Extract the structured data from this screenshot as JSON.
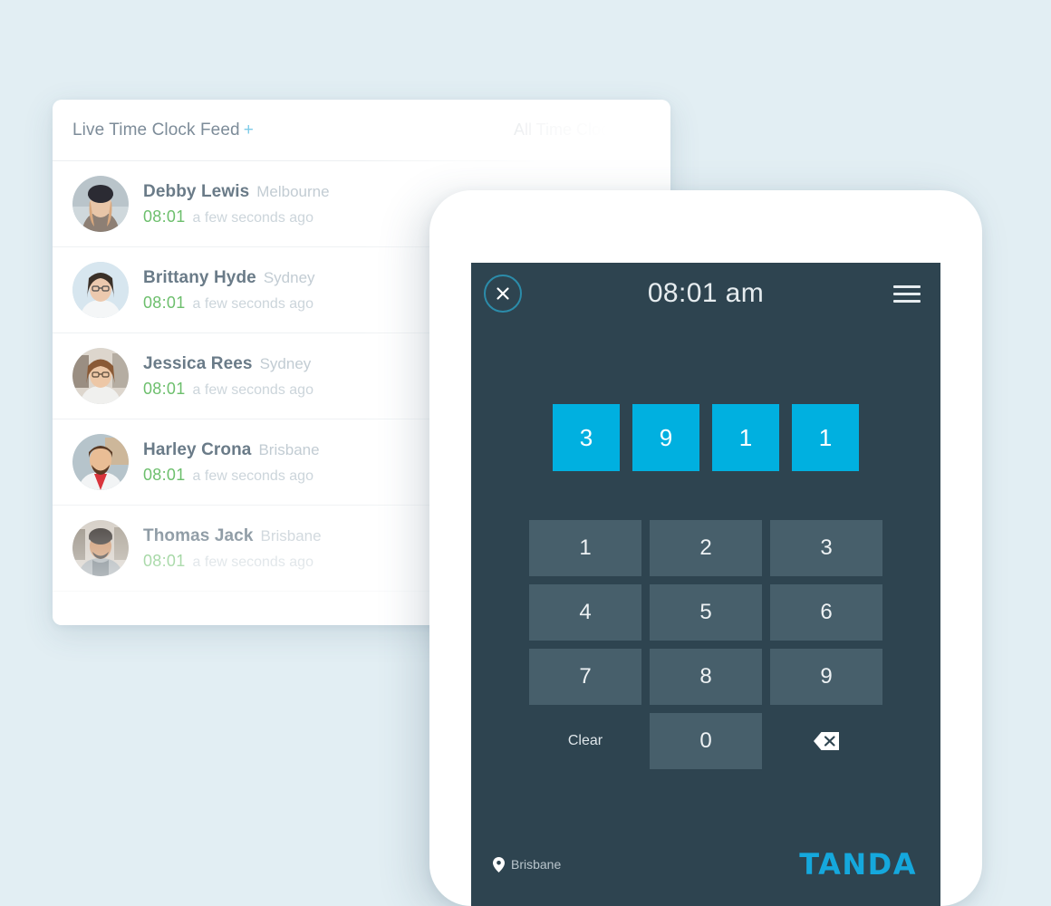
{
  "background_color": "#e2eef3",
  "feed": {
    "title": "Live Time Clock Feed",
    "title_plus": "+",
    "filter_label": "All Time Clocks",
    "filter_caret_icon": "chevron-down-icon",
    "rows": [
      {
        "name": "Debby Lewis",
        "location": "Melbourne",
        "time": "08:01",
        "ago": "a few seconds ago"
      },
      {
        "name": "Brittany Hyde",
        "location": "Sydney",
        "time": "08:01",
        "ago": "a few seconds ago"
      },
      {
        "name": "Jessica Rees",
        "location": "Sydney",
        "time": "08:01",
        "ago": "a few seconds ago"
      },
      {
        "name": "Harley Crona",
        "location": "Brisbane",
        "time": "08:01",
        "ago": "a few seconds ago"
      },
      {
        "name": "Thomas Jack",
        "location": "Brisbane",
        "time": "08:01",
        "ago": "a few seconds ago"
      }
    ],
    "colors": {
      "name": "#6a7b88",
      "location": "#c2ccd3",
      "time": "#6dbf6d",
      "ago": "#ccd5db",
      "plus": "#7ecbe8"
    }
  },
  "phone": {
    "topbar": {
      "close_icon": "close-icon",
      "time": "08:01 am",
      "menu_icon": "hamburger-menu-icon"
    },
    "pin_display": {
      "digits": [
        "3",
        "9",
        "1",
        "1"
      ],
      "tile_color": "#00b0e0"
    },
    "keypad": {
      "keys": [
        {
          "label": "1",
          "type": "digit"
        },
        {
          "label": "2",
          "type": "digit"
        },
        {
          "label": "3",
          "type": "digit"
        },
        {
          "label": "4",
          "type": "digit"
        },
        {
          "label": "5",
          "type": "digit"
        },
        {
          "label": "6",
          "type": "digit"
        },
        {
          "label": "7",
          "type": "digit"
        },
        {
          "label": "8",
          "type": "digit"
        },
        {
          "label": "9",
          "type": "digit"
        },
        {
          "label": "Clear",
          "type": "clear"
        },
        {
          "label": "0",
          "type": "digit"
        },
        {
          "label": "",
          "type": "backspace",
          "icon": "backspace-icon"
        }
      ],
      "key_color": "#475f6b"
    },
    "footer": {
      "location_icon": "map-pin-icon",
      "location": "Brisbane",
      "brand": "TANDA",
      "brand_color": "#15a8dd"
    },
    "screen_color": "#2e4450"
  }
}
